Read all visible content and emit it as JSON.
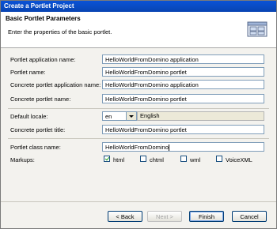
{
  "window": {
    "title": "Create a Portlet Project"
  },
  "header": {
    "title": "Basic Portlet Parameters",
    "description": "Enter the properties of the basic portlet."
  },
  "form": {
    "app_name": {
      "label": "Portlet application name:",
      "value": "HelloWorldFromDomino application"
    },
    "portlet_name": {
      "label": "Portlet name:",
      "value": "HelloWorldFromDomino portlet"
    },
    "concrete_app_name": {
      "label": "Concrete portlet application name:",
      "value": "HelloWorldFromDomino application"
    },
    "concrete_portlet_name": {
      "label": "Concrete portlet name:",
      "value": "HelloWorldFromDomino portlet"
    },
    "default_locale": {
      "label": "Default locale:",
      "value": "en",
      "display": "English"
    },
    "concrete_title": {
      "label": "Concrete portlet title:",
      "value": "HelloWorldFromDomino portlet"
    },
    "class_name": {
      "label": "Portlet class name:",
      "value": "HelloWorldFromDomino"
    },
    "markups": {
      "label": "Markups:",
      "options": [
        {
          "label": "html",
          "checked": true
        },
        {
          "label": "chtml",
          "checked": false
        },
        {
          "label": "wml",
          "checked": false
        },
        {
          "label": "VoiceXML",
          "checked": false
        }
      ]
    }
  },
  "buttons": {
    "back": "< Back",
    "next": "Next >",
    "finish": "Finish",
    "cancel": "Cancel"
  }
}
